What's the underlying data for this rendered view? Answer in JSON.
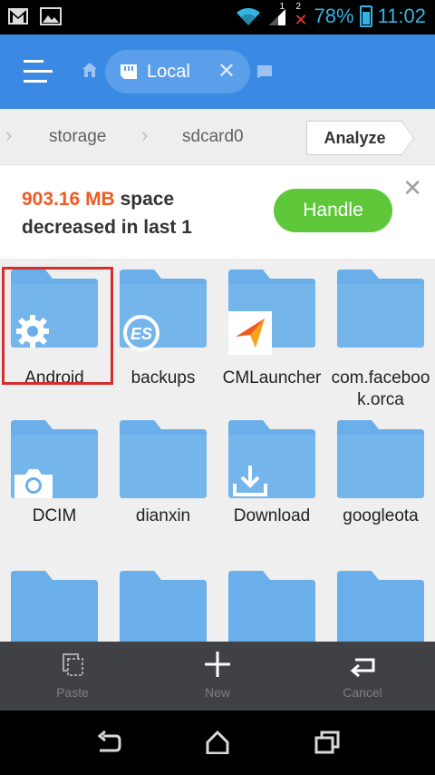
{
  "status_bar": {
    "battery": "78%",
    "time": "11:02",
    "signal_note": "1",
    "sim2_note": "2",
    "icons": [
      "gmail-icon",
      "gallery-icon",
      "wifi-icon",
      "signal-icon",
      "battery-icon"
    ]
  },
  "app_bar": {
    "tab_label": "Local",
    "icons": [
      "menu-icon",
      "home-icon",
      "sdcard-icon",
      "close-icon",
      "window-icon"
    ]
  },
  "breadcrumb": {
    "items": [
      "storage",
      "sdcard0"
    ],
    "analyze_label": "Analyze"
  },
  "notice": {
    "size": "903.16 MB",
    "text_suffix": " space",
    "text_line2": "decreased in last 1",
    "handle_label": "Handle"
  },
  "folders": [
    {
      "name": "Android",
      "badge": "gear-icon"
    },
    {
      "name": "backups",
      "badge": "es-icon"
    },
    {
      "name": "CMLauncher",
      "badge": "cm-icon"
    },
    {
      "name": "com.facebook.orca",
      "badge": ""
    },
    {
      "name": "DCIM",
      "badge": "camera-icon"
    },
    {
      "name": "dianxin",
      "badge": ""
    },
    {
      "name": "Download",
      "badge": "download-icon"
    },
    {
      "name": "googleota",
      "badge": ""
    }
  ],
  "actions": [
    {
      "label": "Paste",
      "icon": "paste-icon"
    },
    {
      "label": "New",
      "icon": "plus-icon"
    },
    {
      "label": "Cancel",
      "icon": "return-icon"
    }
  ],
  "colors": {
    "app_bar": "#3a89e3",
    "handle_button": "#5ec83a",
    "folder": "#6aaeea",
    "size_highlight": "#f05a22",
    "selection_border": "#d32f2f"
  }
}
